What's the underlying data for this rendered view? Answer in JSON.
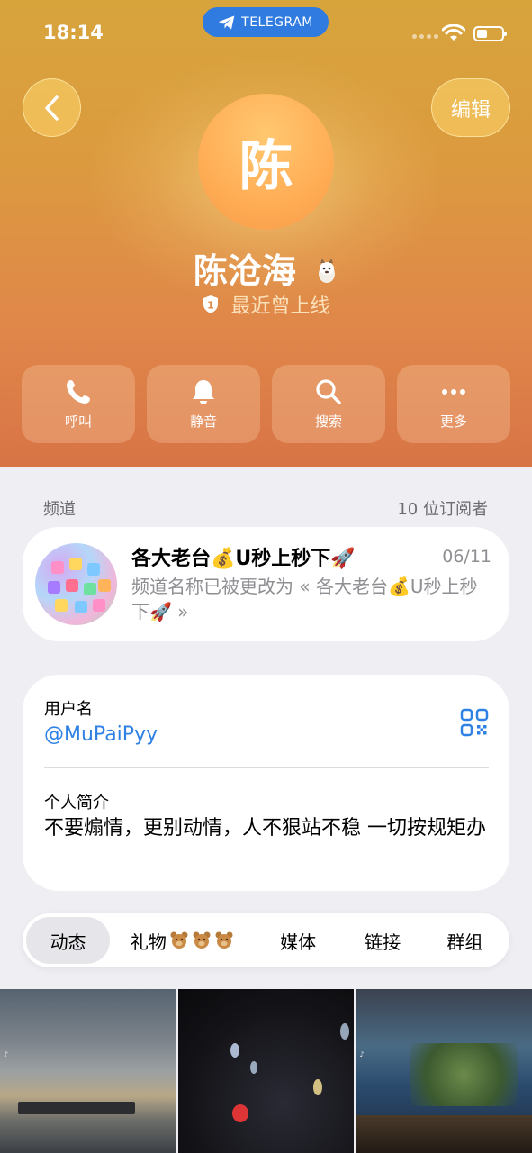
{
  "status_bar": {
    "time": "18:14",
    "app_pill": "TELEGRAM",
    "icons": [
      "signal-dots-icon",
      "wifi-icon",
      "battery-icon"
    ]
  },
  "header": {
    "back_icon": "chevron-left-icon",
    "edit_label": "编辑",
    "avatar_letter": "陈",
    "name": "陈沧海",
    "name_emoji_icon": "dog-icon",
    "last_seen_badge": "1",
    "last_seen": "最近曾上线",
    "colors": {
      "gradient_top": "#d7a43c",
      "gradient_bottom": "#d87446",
      "avatar": "#ffad55"
    }
  },
  "actions": [
    {
      "label": "呼叫",
      "icon": "phone-icon"
    },
    {
      "label": "静音",
      "icon": "bell-icon"
    },
    {
      "label": "搜索",
      "icon": "search-icon"
    },
    {
      "label": "更多",
      "icon": "more-icon"
    }
  ],
  "channel_section": {
    "title": "频道",
    "subscribers": "10 位订阅者",
    "channel": {
      "title": "各大老台💰U秒上秒下🚀",
      "date": "06/11",
      "description": "频道名称已被更改为 « 各大老台💰U秒上秒下🚀 »"
    }
  },
  "info": {
    "username_label": "用户名",
    "username": "@MuPaiPyy",
    "qr_icon": "qr-code-icon",
    "bio_label": "个人简介",
    "bio": "不要煽情，更别动情，人不狠站不稳 一切按规矩办"
  },
  "tabs": {
    "items": [
      "动态",
      "礼物",
      "媒体",
      "链接",
      "群组"
    ],
    "active": "动态",
    "gift_icons": [
      "bear-icon",
      "bear-icon",
      "bear-icon"
    ]
  },
  "accent_color": "#2f82e4"
}
